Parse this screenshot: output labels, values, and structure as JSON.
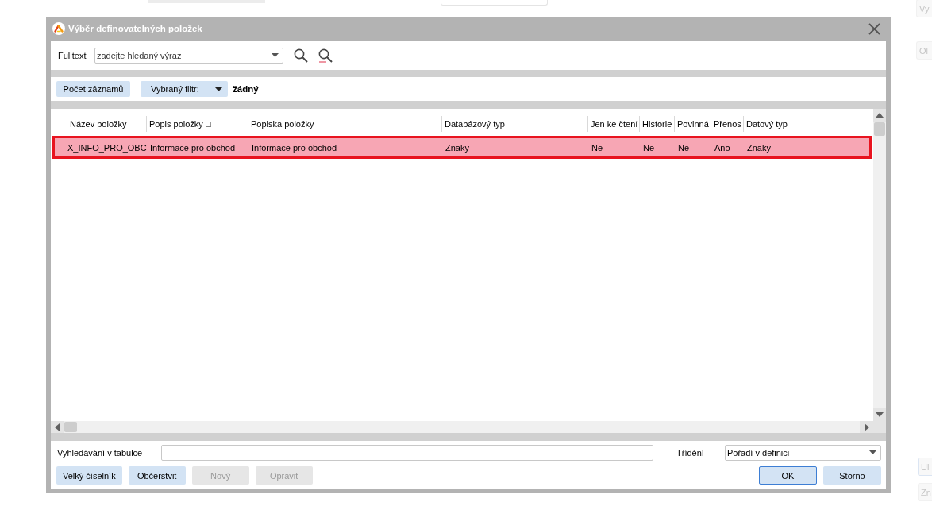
{
  "window": {
    "title": "Výběr definovatelných položek"
  },
  "fulltext": {
    "label": "Fulltext",
    "placeholder": "zadejte hledaný výraz"
  },
  "filter_bar": {
    "count_button": "Počet záznamů",
    "filter_button": "Vybraný filtr:",
    "filter_value": "žádný"
  },
  "table": {
    "columns": [
      "Název položky",
      "Popis položky □",
      "Popiska položky",
      "Databázový typ",
      "Jen ke čtení",
      "Historie",
      "Povinná",
      "Přenos",
      "Datový typ"
    ],
    "rows": [
      {
        "selected": true,
        "cells": [
          "X_INFO_PRO_OBC",
          "Informace pro obchod",
          "Informace pro obchod",
          "Znaky",
          "Ne",
          "Ne",
          "Ne",
          "Ano",
          "Znaky"
        ]
      }
    ]
  },
  "table_search": {
    "label": "Vyhledávání v tabulce"
  },
  "sorting": {
    "label": "Třídění",
    "value": "Pořadí v definici"
  },
  "buttons": [
    {
      "label": "Velký číselník",
      "disabled": false
    },
    {
      "label": "Občerstvit",
      "disabled": false
    },
    {
      "label": "Nový",
      "disabled": true
    },
    {
      "label": "Opravit",
      "disabled": true
    }
  ],
  "dialog_buttons": [
    {
      "label": "OK",
      "default": true
    },
    {
      "label": "Storno",
      "default": false
    }
  ],
  "background": {
    "top_buttons": [
      "Vy",
      "Ol"
    ],
    "bottom_buttons": [
      "Ul",
      "Zn"
    ]
  }
}
